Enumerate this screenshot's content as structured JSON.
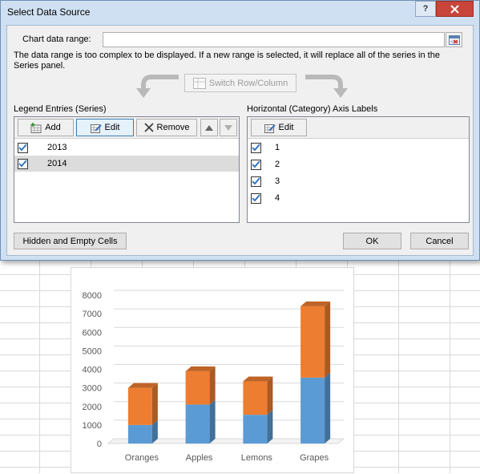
{
  "dialog": {
    "title": "Select Data Source",
    "help_label": "?",
    "chart_range_label": "Chart data range:",
    "chart_range_value": "",
    "message": "The data range is too complex to be displayed. If a new range is selected, it will replace all of the series in the Series panel.",
    "switch_label": "Switch Row/Column",
    "legend": {
      "header": "Legend Entries (Series)",
      "add_label": "Add",
      "edit_label": "Edit",
      "remove_label": "Remove",
      "items": [
        {
          "label": "2013",
          "checked": true,
          "selected": false
        },
        {
          "label": "2014",
          "checked": true,
          "selected": true
        }
      ]
    },
    "axis": {
      "header": "Horizontal (Category) Axis Labels",
      "edit_label": "Edit",
      "items": [
        {
          "label": "1",
          "checked": true
        },
        {
          "label": "2",
          "checked": true
        },
        {
          "label": "3",
          "checked": true
        },
        {
          "label": "4",
          "checked": true
        }
      ]
    },
    "hidden_cells_label": "Hidden and Empty Cells",
    "ok_label": "OK",
    "cancel_label": "Cancel"
  },
  "chart_data": {
    "type": "bar",
    "stacked": true,
    "categories": [
      "Oranges",
      "Apples",
      "Lemons",
      "Grapes"
    ],
    "series": [
      {
        "values": [
          1000,
          2100,
          1550,
          3550
        ],
        "color": "#5b9bd5"
      },
      {
        "values": [
          2000,
          1800,
          1800,
          3850
        ],
        "color": "#ed7d31"
      }
    ],
    "ylim": [
      0,
      8000
    ],
    "yticks": [
      "0",
      "1000",
      "2000",
      "3000",
      "4000",
      "5000",
      "6000",
      "7000",
      "8000"
    ],
    "grid": true
  }
}
